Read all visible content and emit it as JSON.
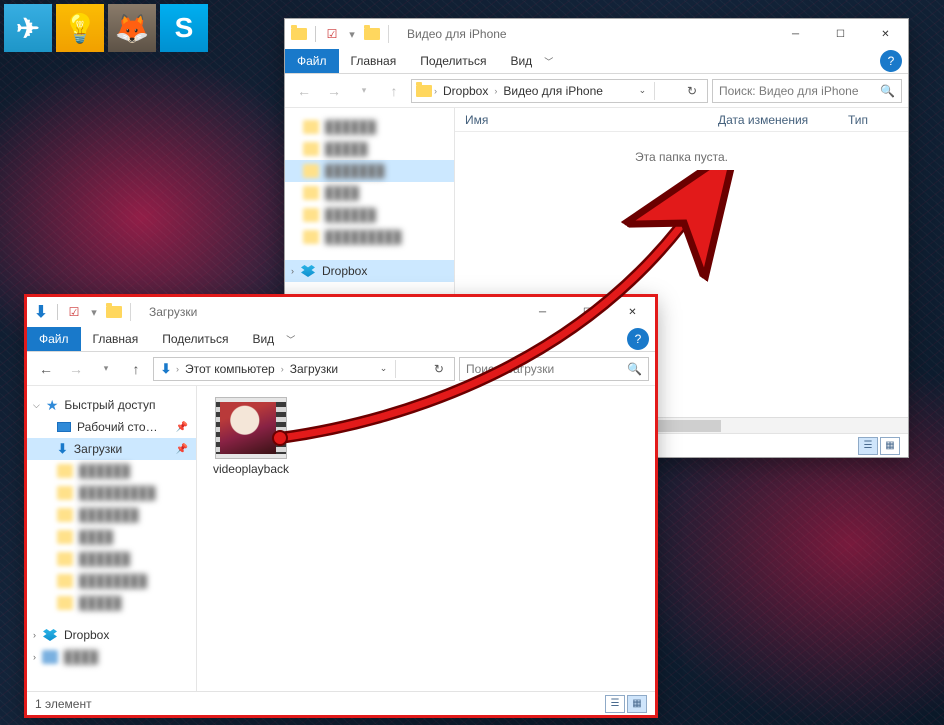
{
  "taskbar_icons": [
    "telegram",
    "keep",
    "gimp",
    "skype"
  ],
  "back_window": {
    "title": "Видео для iPhone",
    "ribbon": {
      "file": "Файл",
      "home": "Главная",
      "share": "Поделиться",
      "view": "Вид"
    },
    "breadcrumb": [
      "Dropbox",
      "Видео для iPhone"
    ],
    "search_placeholder": "Поиск: Видео для iPhone",
    "columns": {
      "name": "Имя",
      "date": "Дата изменения",
      "type": "Тип"
    },
    "empty": "Эта папка пуста.",
    "sidebar_selected": "Dropbox"
  },
  "front_window": {
    "title": "Загрузки",
    "ribbon": {
      "file": "Файл",
      "home": "Главная",
      "share": "Поделиться",
      "view": "Вид"
    },
    "breadcrumb": [
      "Этот компьютер",
      "Загрузки"
    ],
    "search_placeholder": "Поиск: Загрузки",
    "sidebar": {
      "quick_access": "Быстрый доступ",
      "items": [
        {
          "label": "Рабочий сто…",
          "pin": true,
          "icon": "desktop"
        },
        {
          "label": "Загрузки",
          "pin": true,
          "icon": "downloads",
          "selected": true
        }
      ],
      "dropbox": "Dropbox"
    },
    "file": {
      "name": "videoplayback"
    },
    "status": "1 элемент"
  }
}
